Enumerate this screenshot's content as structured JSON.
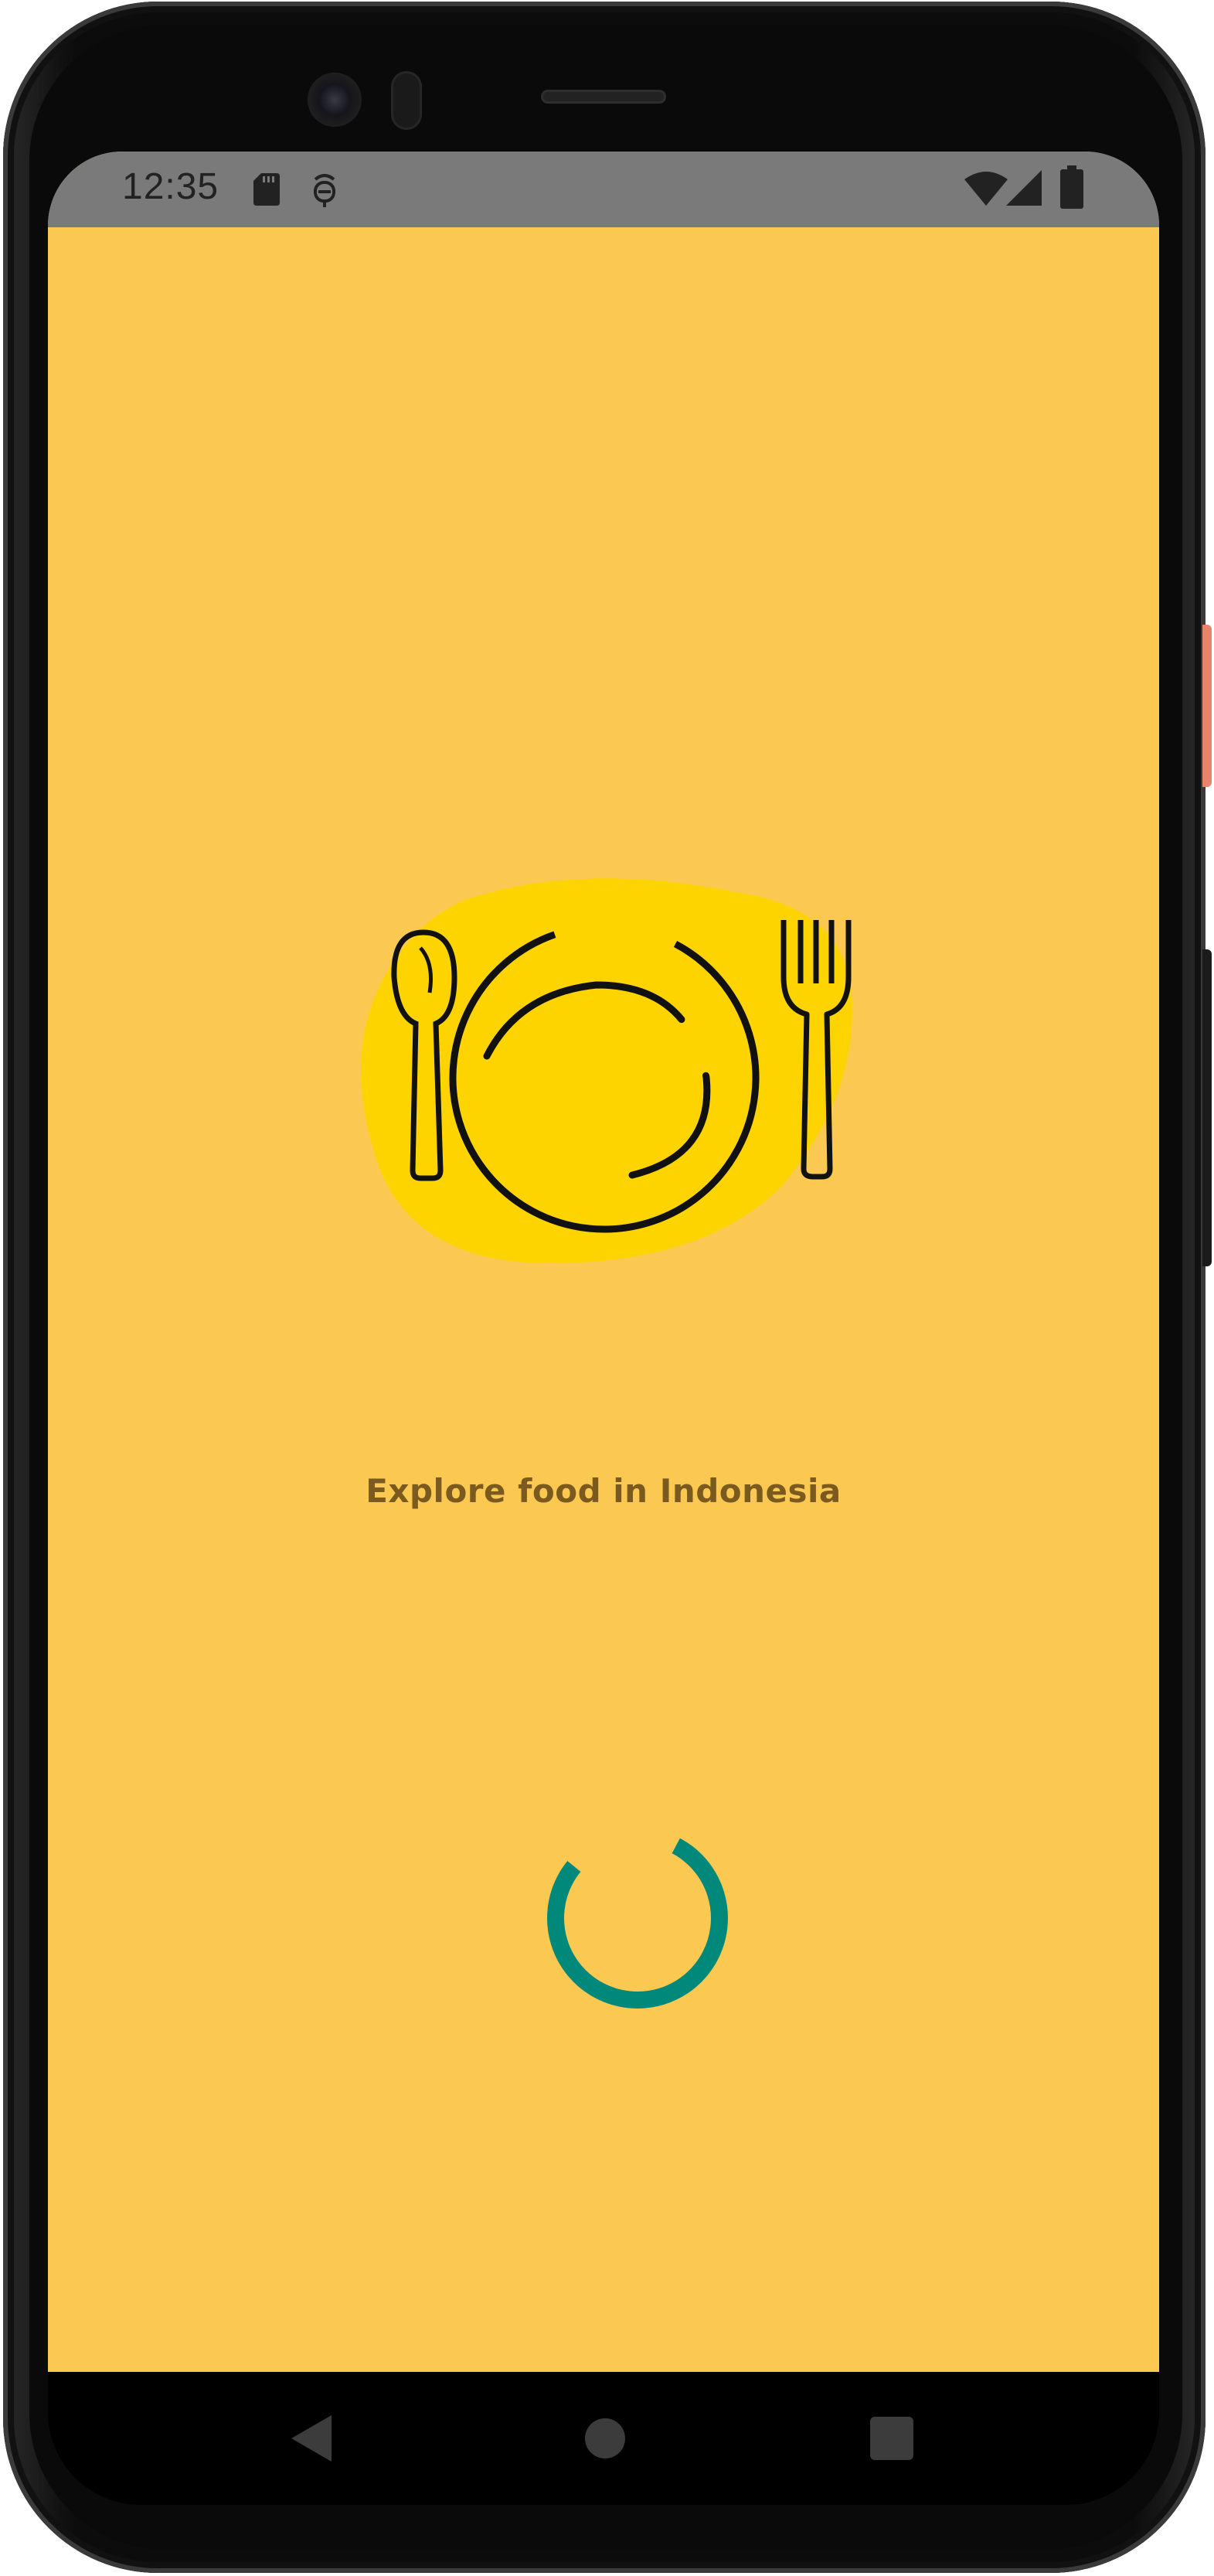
{
  "status_bar": {
    "time": "12:35",
    "icons": [
      "sd-card-icon",
      "assistant-icon",
      "wifi-icon",
      "signal-icon",
      "battery-icon"
    ]
  },
  "splash": {
    "logo_icon": "plate-spoon-fork-icon",
    "tagline": "Explore food in Indonesia",
    "loading_indicator": "circular-progress"
  },
  "navigation_bar": {
    "buttons": [
      "back-icon",
      "home-icon",
      "recents-icon"
    ]
  },
  "colors": {
    "background": "#fbc952",
    "logo_blob": "#fdd400",
    "logo_line": "#111111",
    "tagline": "#7a5a1e",
    "spinner": "#00897b",
    "status_bar": "#7a7a7a",
    "nav_bar": "#000000"
  }
}
